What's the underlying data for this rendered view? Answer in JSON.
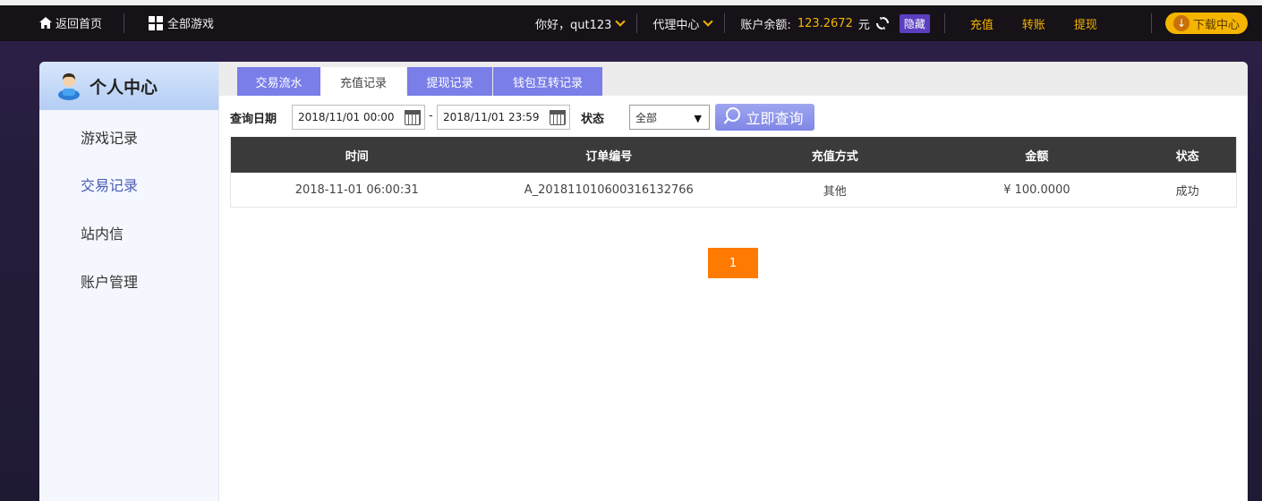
{
  "topbar": {
    "home_label": "返回首页",
    "all_games_label": "全部游戏",
    "greeting": "你好，qut123",
    "agent_center": "代理中心",
    "balance_label": "账户余额:",
    "balance_value": "123.2672",
    "balance_unit": "元",
    "hide_label": "隐藏",
    "recharge": "充值",
    "transfer": "转账",
    "withdraw": "提现",
    "download": "下载中心"
  },
  "sidebar": {
    "title": "个人中心",
    "items": [
      {
        "label": "游戏记录",
        "active": false
      },
      {
        "label": "交易记录",
        "active": true
      },
      {
        "label": "站内信",
        "active": false
      },
      {
        "label": "账户管理",
        "active": false
      }
    ]
  },
  "tabs": [
    {
      "label": "交易流水",
      "active": false
    },
    {
      "label": "充值记录",
      "active": true
    },
    {
      "label": "提现记录",
      "active": false
    },
    {
      "label": "钱包互转记录",
      "active": false
    }
  ],
  "filter": {
    "date_label": "查询日期",
    "start_date": "2018/11/01 00:00",
    "dash": "-",
    "end_date": "2018/11/01 23:59",
    "status_label": "状态",
    "status_value": "全部",
    "query_button": "立即查询"
  },
  "table": {
    "headers": [
      "时间",
      "订单编号",
      "充值方式",
      "金额",
      "状态"
    ],
    "rows": [
      [
        "2018-11-01 06:00:31",
        "A_201811010600316132766",
        "其他",
        "¥ 100.0000",
        "成功"
      ]
    ]
  },
  "pagination": {
    "current": "1"
  },
  "colors": {
    "accent_gold": "#f5b400",
    "tab_purple": "#7a7ee8",
    "pager_orange": "#ff7a00",
    "hide_purple": "#5b3fbf"
  }
}
